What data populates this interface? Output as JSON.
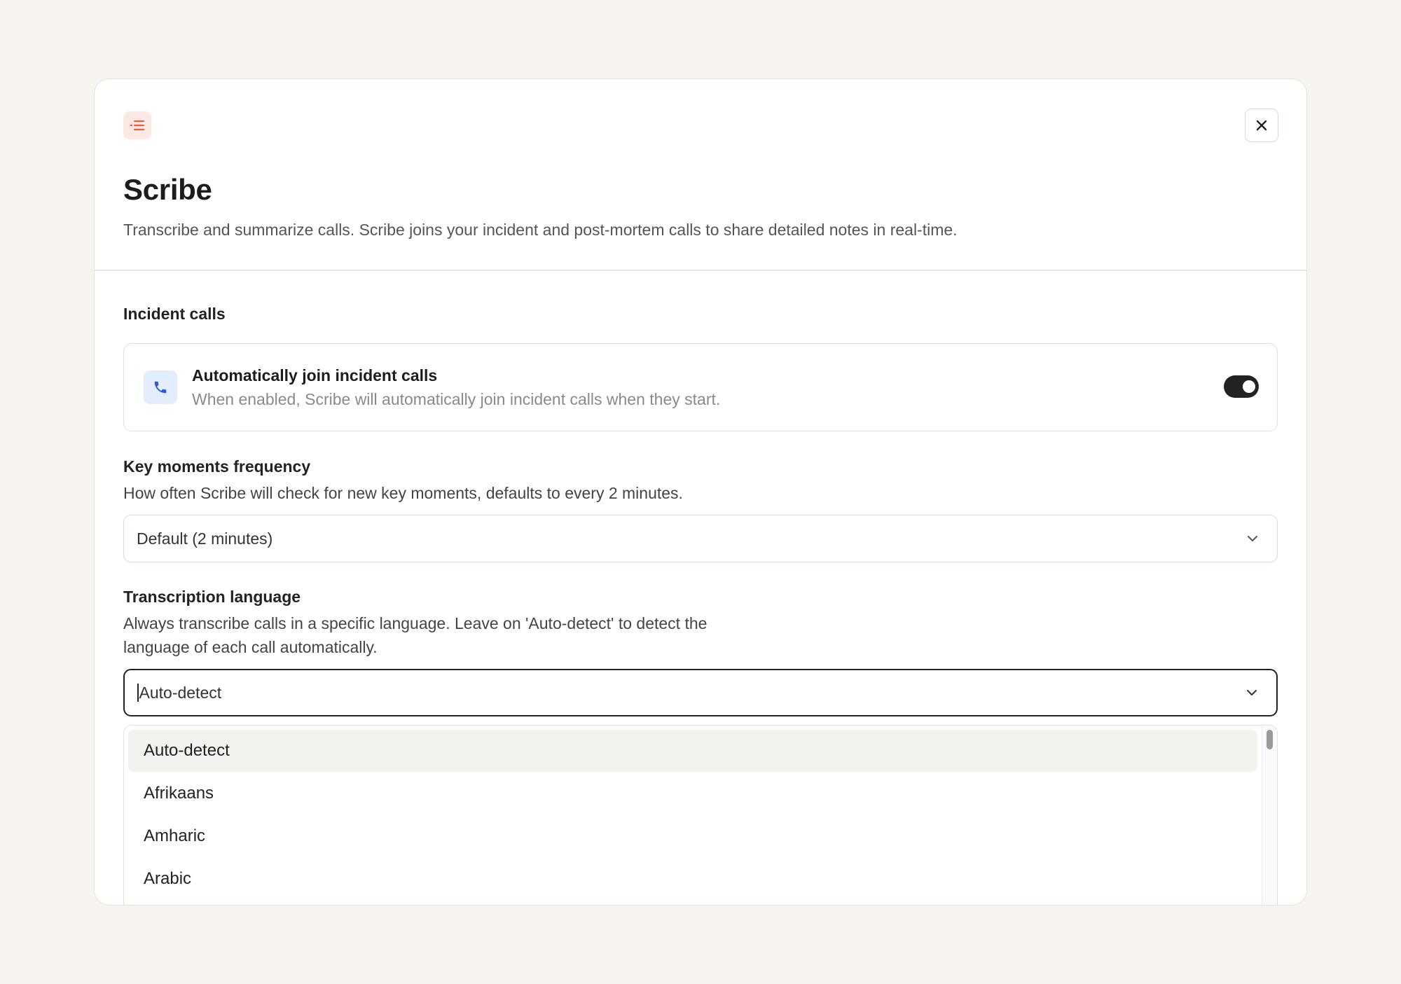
{
  "modal": {
    "title": "Scribe",
    "subtitle": "Transcribe and summarize calls. Scribe joins your incident and post-mortem calls to share detailed notes in real-time.",
    "app_icon": "list-icon",
    "close_icon": "close-icon"
  },
  "incident_calls": {
    "heading": "Incident calls",
    "auto_join": {
      "icon": "phone-icon",
      "title": "Automatically join incident calls",
      "description": "When enabled, Scribe will automatically join incident calls when they start.",
      "enabled": true
    }
  },
  "key_moments": {
    "heading": "Key moments frequency",
    "description": "How often Scribe will check for new key moments, defaults to every 2 minutes.",
    "selected": "Default (2 minutes)"
  },
  "transcription_language": {
    "heading": "Transcription language",
    "description_line1": "Always transcribe calls in a specific language. Leave on 'Auto-detect' to detect the",
    "description_line2": "language of each call automatically.",
    "value": "Auto-detect",
    "options": [
      "Auto-detect",
      "Afrikaans",
      "Amharic",
      "Arabic"
    ],
    "highlighted_index": 0
  },
  "colors": {
    "background": "#f7f4ef",
    "accent_icon_bg": "#fde9e3",
    "accent_icon": "#e8603c",
    "phone_icon_bg": "#e4edfc",
    "phone_icon": "#2a5bd7",
    "toggle_on": "#222222"
  }
}
